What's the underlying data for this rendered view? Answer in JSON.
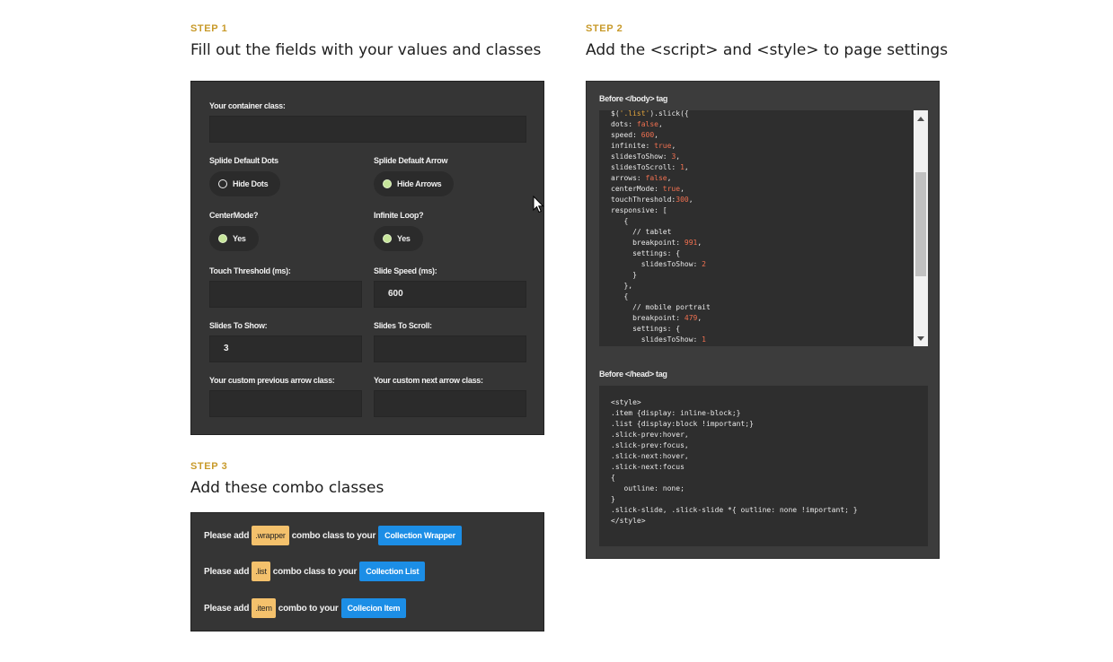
{
  "step1": {
    "label": "STEP 1",
    "title": "Fill out the fields with your values and classes",
    "container_label": "Your container class:",
    "container_value": "",
    "dots_label": "Splide Default Dots",
    "dots_option": "Hide Dots",
    "dots_selected": false,
    "arrow_label": "Splide Default Arrow",
    "arrow_option": "Hide Arrows",
    "arrow_selected": true,
    "center_label": "CenterMode?",
    "center_option": "Yes",
    "center_selected": true,
    "loop_label": "Infinite Loop?",
    "loop_option": "Yes",
    "loop_selected": true,
    "touch_label": "Touch Threshold (ms):",
    "touch_value": "",
    "speed_label": "Slide Speed (ms):",
    "speed_value": "600",
    "show_label": "Slides To Show:",
    "show_value": "3",
    "scroll_label": "Slides To Scroll:",
    "scroll_value": "",
    "prev_label": "Your custom previous arrow class:",
    "prev_value": "",
    "next_label": "Your custom next arrow class:",
    "next_value": ""
  },
  "step2": {
    "label": "STEP 2",
    "title": "Add the <script> and <style> to page settings",
    "body_label": "Before </body> tag",
    "head_label": "Before </head> tag",
    "script_lines": [
      "$('.list').slick({",
      "dots: false,",
      "speed: 600,",
      "infinite: true,",
      "slidesToShow: 3,",
      "slidesToScroll: 1,",
      "arrows: false,",
      "centerMode: true,",
      "touchThreshold:300,",
      "responsive: [",
      "   {",
      "     // tablet",
      "     breakpoint: 991,",
      "     settings: {",
      "       slidesToShow: 2",
      "     }",
      "   },",
      "   {",
      "     // mobile portrait",
      "     breakpoint: 479,",
      "     settings: {",
      "       slidesToShow: 1"
    ],
    "style_lines": [
      "<style>",
      ".item {display: inline-block;}",
      ".list {display:block !important;}",
      ".slick-prev:hover,",
      ".slick-prev:focus,",
      ".slick-next:hover,",
      ".slick-next:focus",
      "{",
      "   outline: none;",
      "}",
      ".slick-slide, .slick-slide *{ outline: none !important; }",
      "</style>"
    ],
    "scroll_position": 0.23
  },
  "step3": {
    "label": "STEP 3",
    "title": "Add these combo classes",
    "rows": [
      {
        "prefix": "Please add",
        "tag": ".wrapper",
        "middle": "combo class to your",
        "target": "Collection Wrapper"
      },
      {
        "prefix": "Please add",
        "tag": ".list",
        "middle": "combo class to your",
        "target": "Collection List"
      },
      {
        "prefix": "Please add",
        "tag": ".item",
        "middle": "combo to your",
        "target": "Collecion Item"
      }
    ]
  },
  "colors": {
    "step_label": "#c89a2a",
    "panel_bg": "#353535",
    "tag_yellow": "#f4c16c",
    "tag_blue": "#1c8ee6",
    "radio_on": "#c6e59a",
    "code_string": "#e6a83e",
    "code_literal": "#f07050"
  },
  "icons": {
    "cursor": "mouse-pointer-icon"
  }
}
